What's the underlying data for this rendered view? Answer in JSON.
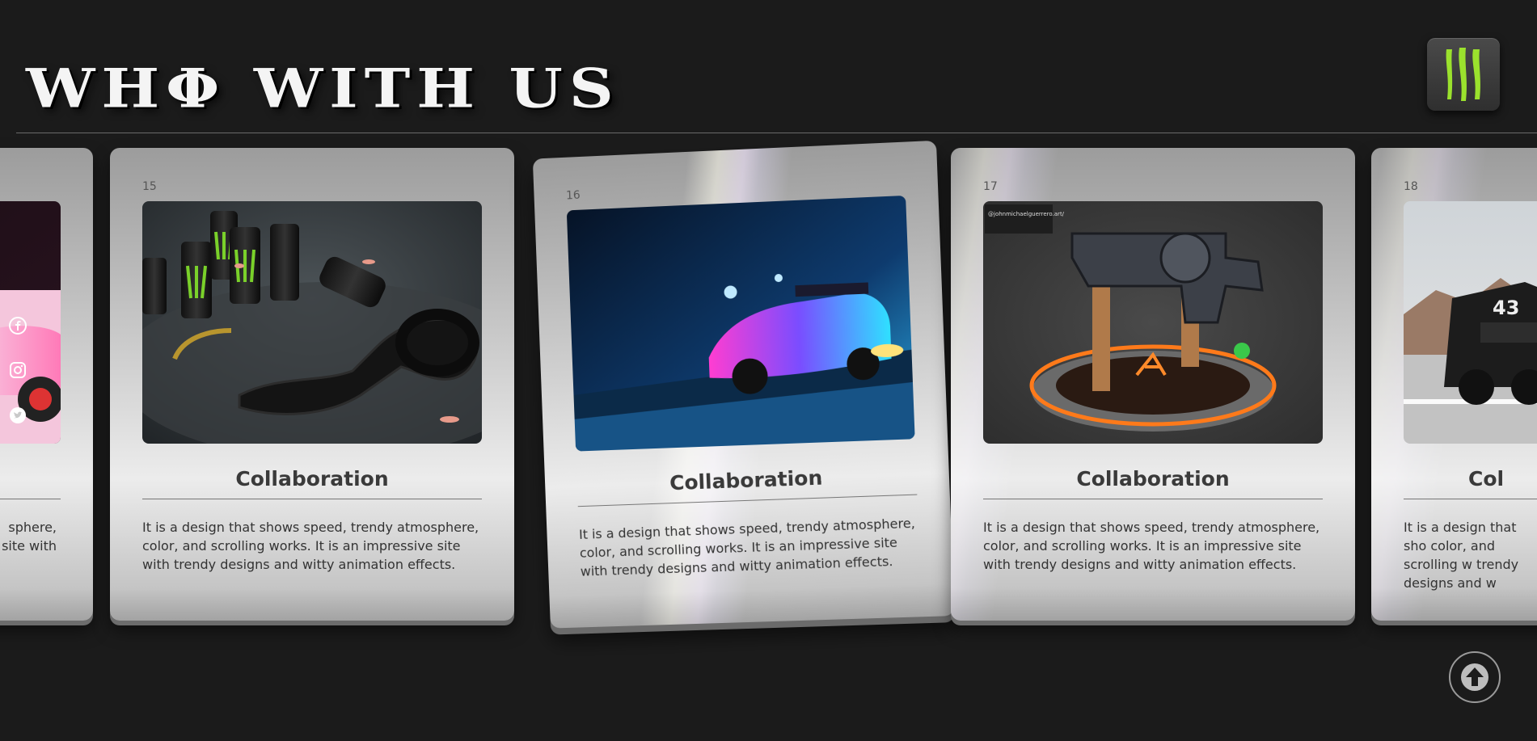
{
  "page": {
    "title": "WHΦ WITH US"
  },
  "logo": {
    "icon": "monster-claw-icon",
    "accent": "#9be22d"
  },
  "cards": [
    {
      "number": "",
      "title": "",
      "description": "sphere,\n site with"
    },
    {
      "number": "15",
      "title": "Collaboration",
      "description": "It is a design that shows speed, trendy atmosphere, color, and scrolling works. It is an impressive site with trendy designs and witty animation effects."
    },
    {
      "number": "16",
      "title": "Collaboration",
      "description": "It is a design that shows speed, trendy atmosphere, color, and scrolling works. It is an impressive site with trendy designs and witty animation effects."
    },
    {
      "number": "17",
      "title": "Collaboration",
      "description": "It is a design that shows speed, trendy atmosphere, color, and scrolling works. It is an impressive site with trendy designs and witty animation effects."
    },
    {
      "number": "18",
      "title": "Col",
      "description": "It is a design that sho color, and scrolling w trendy designs and w"
    }
  ],
  "watermark_text": "@johnmichaelguerrero.art/",
  "social_icons": [
    "facebook-icon",
    "instagram-icon",
    "twitter-icon"
  ],
  "scroll_top": {
    "icon": "arrow-up-icon"
  }
}
